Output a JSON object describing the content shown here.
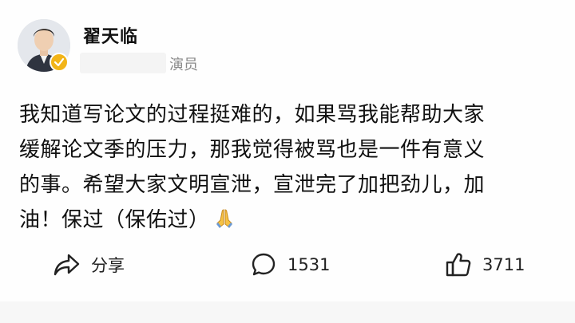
{
  "author": {
    "name": "翟天临",
    "role": "演员",
    "icons": {
      "avatar": "avatar",
      "badge": "verified-badge-icon"
    },
    "colors": {
      "badge": "#f2b418"
    }
  },
  "post": {
    "lines": [
      "我知道写论文的过程挺难的，如果骂我能帮助大家",
      "缓解论文季的压力，那我觉得被骂也是一件有意义",
      "的事。希望大家文明宣泄，宣泄完了加把劲儿，加",
      "油！保过（保佑过）"
    ],
    "trailing_emoji": "folded-hands-emoji"
  },
  "actions": {
    "share": {
      "label": "分享",
      "icon": "share-icon"
    },
    "comment": {
      "count": "1531",
      "icon": "comment-icon"
    },
    "like": {
      "count": "3711",
      "icon": "thumbs-up-icon"
    }
  }
}
